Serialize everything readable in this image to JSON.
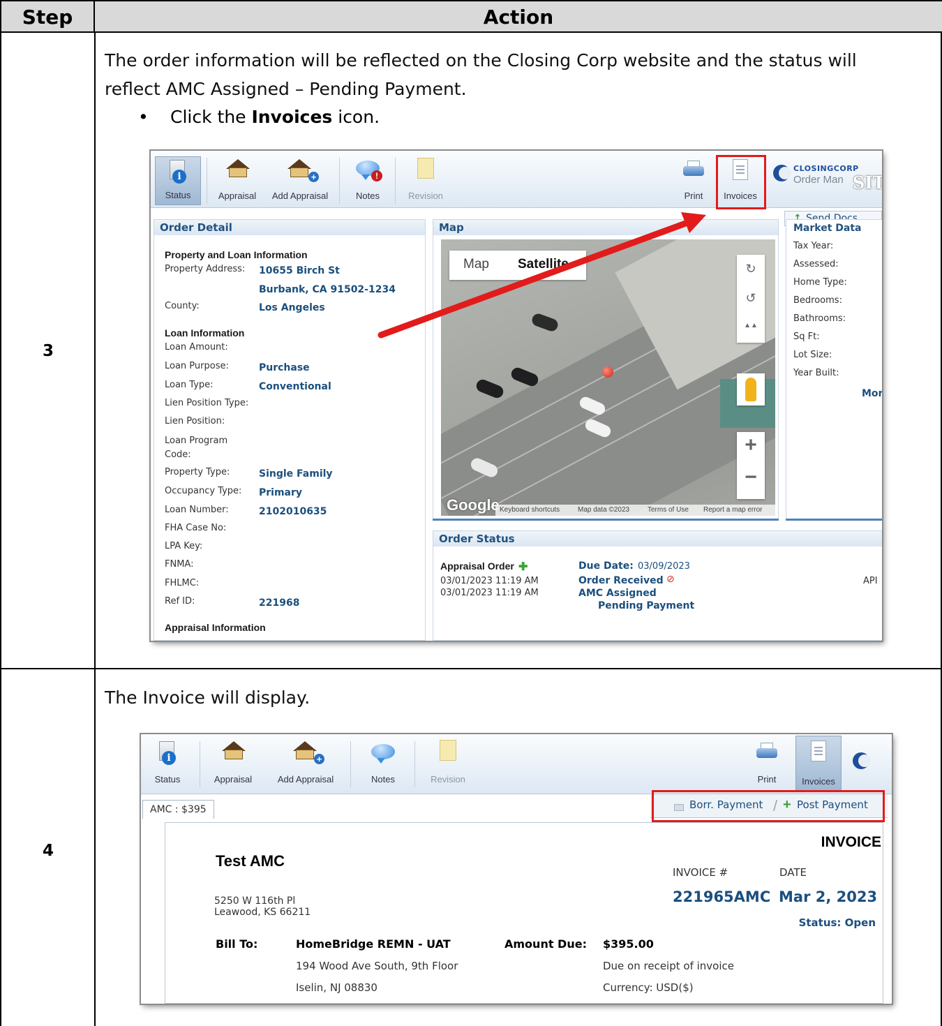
{
  "table": {
    "col_step": "Step",
    "col_action": "Action",
    "rows": [
      {
        "step": "3",
        "text_line1": "The order information will be reflected on the Closing Corp website and the status will",
        "text_line2": "reflect AMC Assigned – Pending Payment.",
        "bullet": "•",
        "bullet_pre": "Click the ",
        "bullet_bold": "Invoices",
        "bullet_post": " icon."
      },
      {
        "step": "4",
        "text_line1": "The Invoice will display."
      }
    ]
  },
  "shot1": {
    "toolbar": {
      "status": "Status",
      "appraisal": "Appraisal",
      "add_appraisal": "Add Appraisal",
      "notes": "Notes",
      "revision": "Revision",
      "print": "Print",
      "invoices": "Invoices",
      "info_glyph": "i",
      "plus_glyph": "+",
      "alert_glyph": "!"
    },
    "brand": {
      "name": "CLOSINGCORP",
      "sub": "Order Man",
      "overlay": "SIT"
    },
    "send_docs": "Send Docs",
    "order_detail": {
      "title": "Order Detail",
      "property_section": "Property and Loan Information",
      "property_address_label": "Property Address:",
      "property_address_line1": "10655 Birch St",
      "property_address_line2": "Burbank, CA 91502-1234",
      "county_label": "County:",
      "county": "Los Angeles",
      "loan_section": "Loan Information",
      "loan_amount_label": "Loan Amount:",
      "loan_purpose_label": "Loan Purpose:",
      "loan_purpose": "Purchase",
      "loan_type_label": "Loan Type:",
      "loan_type": "Conventional",
      "lien_position_type_label": "Lien Position Type:",
      "lien_position_label": "Lien Position:",
      "loan_program_code_label_1": "Loan Program",
      "loan_program_code_label_2": "Code:",
      "property_type_label": "Property Type:",
      "property_type": "Single Family",
      "occupancy_type_label": "Occupancy Type:",
      "occupancy_type": "Primary",
      "loan_number_label": "Loan Number:",
      "loan_number": "2102010635",
      "fha_case_label": "FHA Case No:",
      "lpa_key_label": "LPA Key:",
      "fnma_label": "FNMA:",
      "fhlmc_label": "FHLMC:",
      "ref_id_label": "Ref ID:",
      "ref_id": "221968",
      "appraisal_section": "Appraisal Information"
    },
    "map": {
      "title": "Map",
      "tab_map": "Map",
      "tab_satellite": "Satellite",
      "google": "Google",
      "footer_shortcuts": "Keyboard shortcuts",
      "footer_data": "Map data ©2023",
      "footer_terms": "Terms of Use",
      "footer_report": "Report a map error",
      "rotate_cw": "↻",
      "rotate_ccw": "↺",
      "tilt": "▲▲",
      "zoom_in": "+",
      "zoom_out": "−"
    },
    "market_data": {
      "title": "Market Data",
      "tax_year": "Tax Year:",
      "assessed": "Assessed:",
      "home_type": "Home Type:",
      "bedrooms": "Bedrooms:",
      "bathrooms": "Bathrooms:",
      "sq_ft": "Sq Ft:",
      "lot_size": "Lot Size:",
      "year_built": "Year Built:",
      "more": "Mor"
    },
    "order_status": {
      "title": "Order Status",
      "appraisal_order": "Appraisal Order",
      "due_date_label": "Due Date:",
      "due_date": "03/09/2023",
      "time1": "03/01/2023 11:19 AM",
      "time2": "03/01/2023 11:19 AM",
      "order_received": "Order Received",
      "amc_assigned": "AMC Assigned",
      "pending_payment": "Pending Payment",
      "api": "API",
      "block_glyph": "⊘"
    }
  },
  "shot2": {
    "toolbar": {
      "status": "Status",
      "appraisal": "Appraisal",
      "add_appraisal": "Add Appraisal",
      "notes": "Notes",
      "revision": "Revision",
      "print": "Print",
      "invoices": "Invoices",
      "info_glyph": "i",
      "plus_glyph": "+"
    },
    "tab_amc": "AMC : $395",
    "borr_payment": "Borr. Payment",
    "post_payment": "Post Payment",
    "post_plus": "+",
    "invoice": {
      "heading": "INVOICE",
      "company": "Test AMC",
      "address1": "5250 W 116th Pl",
      "address2": "Leawood, KS 66211",
      "invoice_no_label": "INVOICE #",
      "date_label": "DATE",
      "invoice_no": "221965AMC",
      "date": "Mar 2, 2023",
      "status": "Status: Open",
      "bill_to_label": "Bill To:",
      "bill_to_name": "HomeBridge REMN - UAT",
      "bill_to_addr1": "194 Wood Ave South, 9th Floor",
      "bill_to_addr2": "Iselin, NJ 08830",
      "amount_due_label": "Amount Due:",
      "amount_due": "$395.00",
      "due_terms": "Due on receipt of invoice",
      "currency": "Currency: USD($)"
    }
  },
  "colors": {
    "highlight": "#e21b1b",
    "link_blue": "#1b4f7e",
    "header_gray": "#d9d9d9"
  }
}
